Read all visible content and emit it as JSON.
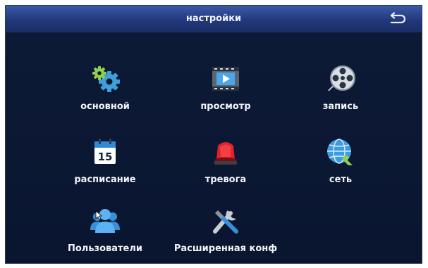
{
  "window": {
    "title": "настройки"
  },
  "menu": {
    "items": [
      {
        "id": "basic",
        "label": "основной",
        "icon": "gears-icon"
      },
      {
        "id": "playback",
        "label": "просмотр",
        "icon": "film-play-icon"
      },
      {
        "id": "record",
        "label": "запись",
        "icon": "film-reel-icon"
      },
      {
        "id": "schedule",
        "label": "расписание",
        "icon": "calendar-icon",
        "calendar_day": "15"
      },
      {
        "id": "alarm",
        "label": "тревога",
        "icon": "alarm-siren-icon"
      },
      {
        "id": "network",
        "label": "сеть",
        "icon": "globe-network-icon"
      },
      {
        "id": "users",
        "label": "Пользователи",
        "icon": "users-icon"
      },
      {
        "id": "advanced",
        "label": "Расширенная конф",
        "icon": "tools-icon"
      }
    ]
  },
  "colors": {
    "title_bar": "#22387a",
    "background": "#0b1730",
    "label_text": "#f2f4fa"
  }
}
